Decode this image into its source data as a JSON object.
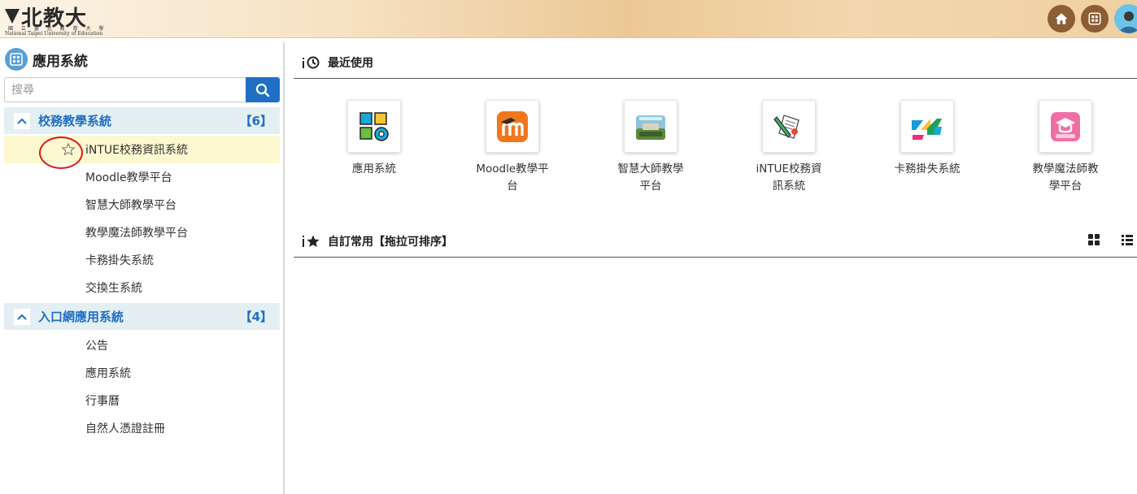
{
  "header": {
    "logo_text": "北教大",
    "logo_sub_cn": "國 立 臺 北 教 育 大 學",
    "logo_sub_en": "National Taipei University of Education",
    "buttons": [
      {
        "name": "home",
        "icon": "home-icon"
      },
      {
        "name": "apps",
        "icon": "grid-icon"
      }
    ],
    "accent_color": "#8b5e34"
  },
  "sidebar": {
    "title": "應用系統",
    "search": {
      "placeholder": "搜尋",
      "value": ""
    },
    "groups": [
      {
        "label": "校務教學系統",
        "count": "【6】",
        "expanded": true,
        "items": [
          {
            "label": "iNTUE校務資訊系統",
            "highlighted": true
          },
          {
            "label": "Moodle教學平台"
          },
          {
            "label": "智慧大師教學平台"
          },
          {
            "label": "教學魔法師教學平台"
          },
          {
            "label": "卡務掛失系統"
          },
          {
            "label": "交換生系統"
          }
        ]
      },
      {
        "label": "入口網應用系統",
        "count": "【4】",
        "expanded": true,
        "items": [
          {
            "label": "公告"
          },
          {
            "label": "應用系統"
          },
          {
            "label": "行事曆"
          },
          {
            "label": "自然人憑證註冊"
          }
        ]
      }
    ],
    "accent_color": "#1f6fc5"
  },
  "main": {
    "recent": {
      "title": "最近使用",
      "apps": [
        {
          "label": "應用系統",
          "icon": "apps-grid-gear-icon"
        },
        {
          "label": "Moodle教學平台",
          "icon": "moodle-icon"
        },
        {
          "label": "智慧大師教學平台",
          "icon": "campus-photo-icon"
        },
        {
          "label": "iNTUE校務資訊系統",
          "icon": "document-pen-icon"
        },
        {
          "label": "卡務掛失系統",
          "icon": "card-logo-icon"
        },
        {
          "label": "教學魔法師教學平台",
          "icon": "graduation-cap-icon"
        }
      ]
    },
    "favorites": {
      "title": "自訂常用【拖拉可排序】"
    }
  }
}
